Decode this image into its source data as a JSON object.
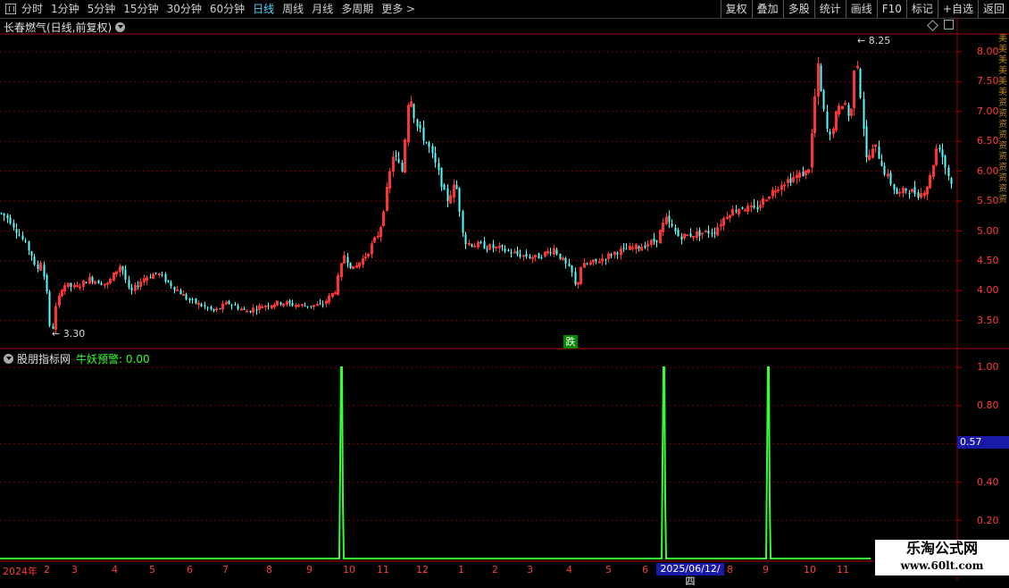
{
  "toolbar": {
    "periods": [
      "分时",
      "1分钟",
      "5分钟",
      "15分钟",
      "30分钟",
      "60分钟",
      "日线",
      "周线",
      "月线",
      "多周期",
      "更多 >"
    ],
    "active_period": "日线",
    "right_buttons": [
      "复权",
      "叠加",
      "多股",
      "统计",
      "画线",
      "F10",
      "标记",
      "+自选",
      "返回"
    ]
  },
  "main_panel": {
    "title": "长春燃气(日线,前复权)",
    "high_label": "8.25",
    "low_label": "3.30",
    "signal_label": "跌",
    "y_ticks": [
      "8.00",
      "7.50",
      "7.00",
      "6.50",
      "6.00",
      "5.50",
      "5.00",
      "4.50",
      "4.00",
      "3.50"
    ]
  },
  "sub_panel": {
    "name": "股朋指标网",
    "indicator": "牛妖预警: 0.00",
    "y_ticks": [
      "1.00",
      "0.80",
      "0.40",
      "0.20"
    ],
    "cursor_value": "0.57"
  },
  "x_axis": {
    "labels": [
      "2024年",
      "2",
      "3",
      "4",
      "5",
      "6",
      "7",
      "8",
      "9",
      "10",
      "11",
      "12",
      "1",
      "2",
      "3",
      "4",
      "5",
      "6",
      "2025/06/12/四",
      "8",
      "9",
      "10",
      "11"
    ],
    "crosshair_date": "2025/06/12/四"
  },
  "right_strip_text": "美美美美美美资资资资资资资资资资",
  "watermark": {
    "line1": "乐淘公式网",
    "line2": "www.60lt.com"
  },
  "colors": {
    "up": "#ff3232",
    "down": "#54ffff",
    "grid": "#8b0000",
    "signal": "#33ff33",
    "axis": "#ff3b3b"
  },
  "chart_data": {
    "type": "candlestick+line",
    "price_anchors": [
      [
        0,
        5.3
      ],
      [
        10,
        5.2
      ],
      [
        25,
        4.85
      ],
      [
        35,
        4.6
      ],
      [
        40,
        4.3
      ],
      [
        45,
        4.5
      ],
      [
        52,
        4.0
      ],
      [
        55,
        3.4
      ],
      [
        58,
        3.3
      ],
      [
        62,
        3.7
      ],
      [
        70,
        4.1
      ],
      [
        85,
        4.05
      ],
      [
        100,
        4.2
      ],
      [
        120,
        4.1
      ],
      [
        135,
        4.45
      ],
      [
        145,
        3.95
      ],
      [
        160,
        4.2
      ],
      [
        175,
        4.3
      ],
      [
        195,
        4.05
      ],
      [
        210,
        3.85
      ],
      [
        225,
        3.75
      ],
      [
        240,
        3.65
      ],
      [
        255,
        3.8
      ],
      [
        275,
        3.65
      ],
      [
        295,
        3.75
      ],
      [
        315,
        3.8
      ],
      [
        335,
        3.75
      ],
      [
        360,
        3.75
      ],
      [
        375,
        4.0
      ],
      [
        385,
        4.6
      ],
      [
        395,
        4.35
      ],
      [
        410,
        4.6
      ],
      [
        425,
        5.0
      ],
      [
        432,
        5.6
      ],
      [
        440,
        6.3
      ],
      [
        450,
        6.0
      ],
      [
        458,
        7.4
      ],
      [
        465,
        6.8
      ],
      [
        472,
        6.6
      ],
      [
        480,
        6.4
      ],
      [
        490,
        6.0
      ],
      [
        500,
        5.5
      ],
      [
        510,
        5.8
      ],
      [
        520,
        4.8
      ],
      [
        540,
        4.75
      ],
      [
        560,
        4.7
      ],
      [
        580,
        4.6
      ],
      [
        600,
        4.55
      ],
      [
        620,
        4.7
      ],
      [
        640,
        4.3
      ],
      [
        645,
        4.0
      ],
      [
        650,
        4.4
      ],
      [
        670,
        4.5
      ],
      [
        690,
        4.65
      ],
      [
        720,
        4.75
      ],
      [
        735,
        4.85
      ],
      [
        745,
        5.2
      ],
      [
        760,
        4.9
      ],
      [
        780,
        4.95
      ],
      [
        800,
        5.0
      ],
      [
        815,
        5.3
      ],
      [
        830,
        5.4
      ],
      [
        845,
        5.35
      ],
      [
        860,
        5.6
      ],
      [
        875,
        5.8
      ],
      [
        890,
        5.9
      ],
      [
        905,
        6.0
      ],
      [
        910,
        6.8
      ],
      [
        915,
        7.8
      ],
      [
        920,
        7.2
      ],
      [
        928,
        6.5
      ],
      [
        935,
        6.9
      ],
      [
        945,
        7.2
      ],
      [
        952,
        6.8
      ],
      [
        958,
        8.1
      ],
      [
        965,
        7.0
      ],
      [
        970,
        6.2
      ],
      [
        980,
        6.4
      ],
      [
        990,
        6.0
      ],
      [
        1005,
        5.6
      ],
      [
        1015,
        5.7
      ],
      [
        1030,
        5.6
      ],
      [
        1040,
        5.8
      ],
      [
        1050,
        6.5
      ],
      [
        1060,
        6.0
      ],
      [
        1068,
        5.7
      ]
    ],
    "signal_x": [
      382,
      743,
      860
    ],
    "signal_value": 1.0
  }
}
